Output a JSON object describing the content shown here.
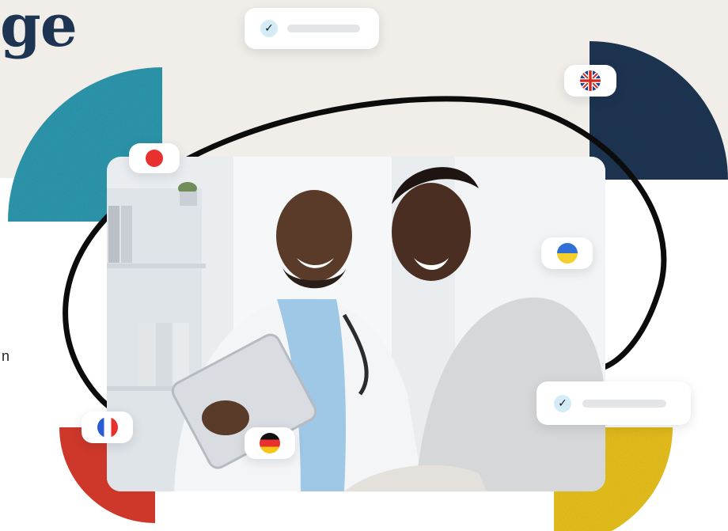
{
  "hero": {
    "headline_fragment": "ge",
    "side_text_fragment": "n"
  },
  "badges": {
    "top_check": {
      "icon": "check-icon"
    },
    "bottom_check": {
      "icon": "check-icon"
    },
    "language_flags": [
      {
        "name": "japan-flag",
        "color": "#e8312f"
      },
      {
        "name": "uk-flag",
        "colors": [
          "#1d3f8f",
          "#ffffff",
          "#d52b1e"
        ]
      },
      {
        "name": "ukraine-flag",
        "colors": [
          "#2f6fd6",
          "#f5cf2c"
        ]
      },
      {
        "name": "france-flag",
        "colors": [
          "#2a5bd7",
          "#ffffff",
          "#e8312f"
        ]
      },
      {
        "name": "germany-flag",
        "colors": [
          "#111111",
          "#e8312f",
          "#f5c518"
        ]
      }
    ]
  },
  "theme": {
    "navy": "#1d3553",
    "teal": "#2e97ad",
    "red": "#d63a2d",
    "yellow": "#e7c01b",
    "beige": "#f1ede8"
  },
  "photo": {
    "subject": "doctor-and-patient-with-tablet"
  }
}
